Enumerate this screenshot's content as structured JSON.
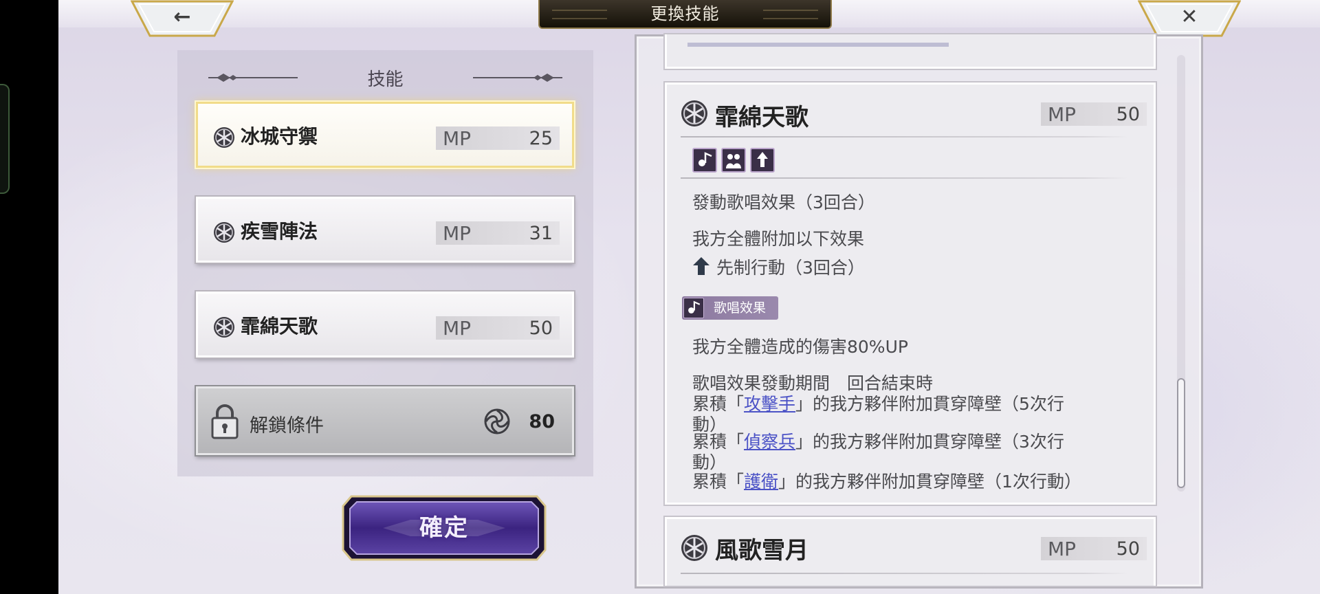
{
  "header": {
    "title": "更換技能",
    "back_icon": "←",
    "close_icon": "✕"
  },
  "skills_panel": {
    "heading": "技能",
    "skills": [
      {
        "name": "冰城守禦",
        "mp_label": "MP",
        "mp": "25",
        "selected": true
      },
      {
        "name": "疾雪陣法",
        "mp_label": "MP",
        "mp": "31",
        "selected": false
      },
      {
        "name": "霏綿天歌",
        "mp_label": "MP",
        "mp": "50",
        "selected": false
      }
    ],
    "unlock": {
      "label": "解鎖條件",
      "value": "80"
    }
  },
  "confirm_label": "確定",
  "detail": {
    "current": {
      "name": "霏綿天歌",
      "mp_label": "MP",
      "mp": "50",
      "line1": "發動歌唱效果（3回合）",
      "line2": "我方全體附加以下效果",
      "line3": "先制行動（3回合）",
      "song_badge": "歌唱效果",
      "line4": "我方全體造成的傷害80%UP",
      "line5": "歌唱效果發動期間　回合結束時",
      "line6_pre": "累積「",
      "line6_link": "攻擊手",
      "line6_post": "」的我方夥伴附加貫穿障壁（5次行",
      "line7": "動）",
      "line8_pre": "累積「",
      "line8_link": "偵察兵",
      "line8_post": "」的我方夥伴附加貫穿障壁（3次行",
      "line9": "動）",
      "line10_pre": "累積「",
      "line10_link": "護衛",
      "line10_post": "」的我方夥伴附加貫穿障壁（1次行動）"
    },
    "next": {
      "name": "風歌雪月",
      "mp_label": "MP",
      "mp": "50"
    }
  },
  "colors": {
    "accent_gold": "#f1dc8a",
    "link_blue": "#4b52c6",
    "confirm_purple": "#4a2f8f"
  }
}
